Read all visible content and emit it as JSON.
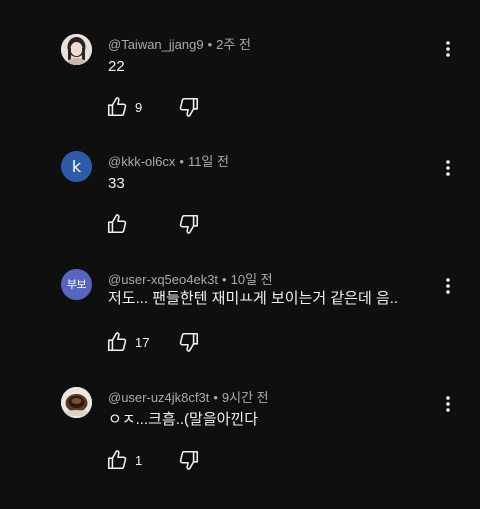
{
  "comments": [
    {
      "author": "@Taiwan_jjang9",
      "time": "2주 전",
      "text": "22",
      "likes": "9",
      "avatar": {
        "type": "photo",
        "letter": ""
      }
    },
    {
      "author": "@kkk-ol6cx",
      "time": "11일 전",
      "text": "33",
      "likes": "",
      "avatar": {
        "type": "letter",
        "letter": "k",
        "color": "#2e5aa8"
      }
    },
    {
      "author": "@user-xq5eo4ek3t",
      "time": "10일 전",
      "text": "저도... 팬들한텐 재미ㅛ게 보이는거 같은데 음..",
      "likes": "17",
      "avatar": {
        "type": "letter",
        "letter": "부보",
        "color": "#5865c0"
      }
    },
    {
      "author": "@user-uz4jk8cf3t",
      "time": "9시간 전",
      "text": "ㅇㅈ...크흠..(말을아낀다",
      "likes": "1",
      "avatar": {
        "type": "photo",
        "letter": ""
      }
    }
  ],
  "separator": "•",
  "icons": {
    "like": "thumbs-up-icon",
    "dislike": "thumbs-down-icon",
    "more": "more-vert-icon"
  }
}
